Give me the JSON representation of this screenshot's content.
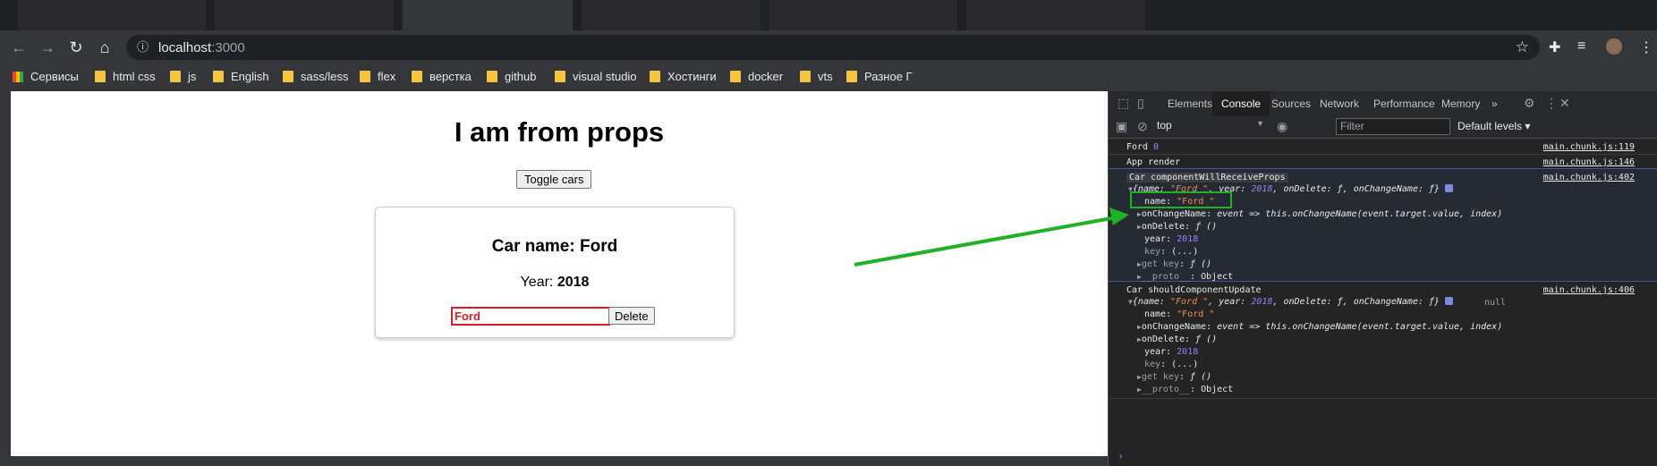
{
  "browser": {
    "url_host": "localhost",
    "url_port": ":3000",
    "bookmarks": [
      "Сервисы",
      "html css",
      "js",
      "English",
      "sass/less",
      "flex",
      "верстка",
      "github",
      "visual studio",
      "Хостинги",
      "docker",
      "vts",
      "Разное Г"
    ]
  },
  "page": {
    "title": "I am from props",
    "toggle_label": "Toggle cars",
    "car": {
      "name_label": "Car name: Ford",
      "year_prefix": "Year: ",
      "year_value": "2018",
      "input_value": "Ford",
      "delete_label": "Delete"
    }
  },
  "devtools": {
    "tabs": [
      "Elements",
      "Console",
      "Sources",
      "Network",
      "Performance",
      "Memory"
    ],
    "active_tab": "Console",
    "more_tabs": "»",
    "context": "top",
    "filter_placeholder": "Filter",
    "levels": "Default levels ▾",
    "console": {
      "line1": {
        "text": "Ford",
        "num": "0",
        "src": "main.chunk.js:119"
      },
      "line2": {
        "text": "App render",
        "src": "main.chunk.js:146"
      },
      "group1": {
        "header": "Car componentWillReceiveProps",
        "src": "main.chunk.js:402",
        "summary_pre": "{name: ",
        "summary_name": "\"Ford \"",
        "summary_mid": ", year: ",
        "summary_year": "2018",
        "summary_post": ", onDelete: ƒ, onChangeName: ƒ}",
        "props": [
          {
            "key": "name",
            "pre": "\"",
            "val": "Ford",
            "post": " \""
          },
          {
            "key": "onChangeName",
            "val": "event => this.onChangeName(event.target.value, index)"
          },
          {
            "key": "onDelete",
            "val": "ƒ ()"
          },
          {
            "key": "year",
            "val": "2018"
          },
          {
            "key": "key",
            "val": "(...)"
          },
          {
            "key": "get key",
            "val": "ƒ ()"
          },
          {
            "key": "__proto__",
            "val": "Object"
          }
        ]
      },
      "group2": {
        "header": "Car  shouldComponentUpdate",
        "src": "main.chunk.js:406",
        "null_val": "null",
        "summary_pre": "{name: ",
        "summary_name": "\"Ford \"",
        "summary_mid": ", year: ",
        "summary_year": "2018",
        "summary_post": ", onDelete: ƒ, onChangeName: ƒ}",
        "props": [
          {
            "key": "name",
            "pre": "\"",
            "val": "Ford",
            "post": " \""
          },
          {
            "key": "onChangeName",
            "val": "event => this.onChangeName(event.target.value, index)"
          },
          {
            "key": "onDelete",
            "val": "ƒ ()"
          },
          {
            "key": "year",
            "val": "2018"
          },
          {
            "key": "key",
            "val": "(...)"
          },
          {
            "key": "get key",
            "val": "ƒ ()"
          },
          {
            "key": "__proto__",
            "val": "Object"
          }
        ]
      }
    }
  },
  "colors": {
    "annotation_arrow": "#1fb126",
    "input_error": "#e01b24",
    "string_value": "#f28b54",
    "number_value": "#9980ff"
  }
}
